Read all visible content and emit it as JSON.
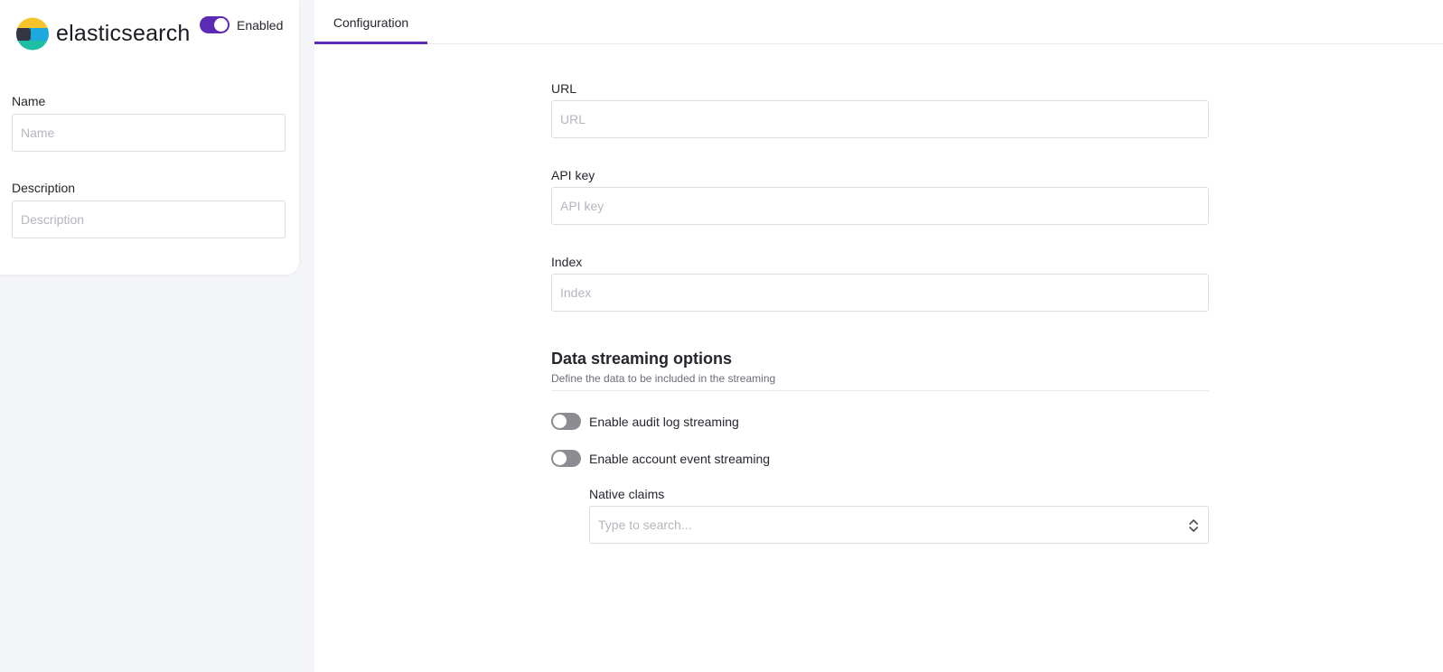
{
  "brand": {
    "name": "elasticsearch",
    "enabled_label": "Enabled",
    "enabled": true
  },
  "general": {
    "name_label": "Name",
    "name_placeholder": "Name",
    "name_value": "",
    "description_label": "Description",
    "description_placeholder": "Description",
    "description_value": ""
  },
  "tabs": [
    {
      "label": "Configuration",
      "active": true
    }
  ],
  "config": {
    "url_label": "URL",
    "url_placeholder": "URL",
    "api_key_label": "API key",
    "api_key_placeholder": "API key",
    "index_label": "Index",
    "index_placeholder": "Index"
  },
  "streaming": {
    "title": "Data streaming options",
    "subtitle": "Define the data to be included in the streaming",
    "audit_log_label": "Enable audit log streaming",
    "audit_log_enabled": false,
    "account_event_label": "Enable account event streaming",
    "account_event_enabled": false,
    "native_claims_label": "Native claims",
    "native_claims_placeholder": "Type to search..."
  },
  "colors": {
    "accent": "#5b2bb5",
    "toggle_off": "#8c8c92",
    "background": "#f4f5f9",
    "text": "#27262e"
  },
  "icons": {
    "select_chevron": "chevron-up-down-icon",
    "logo": "elasticsearch-logo-icon"
  }
}
